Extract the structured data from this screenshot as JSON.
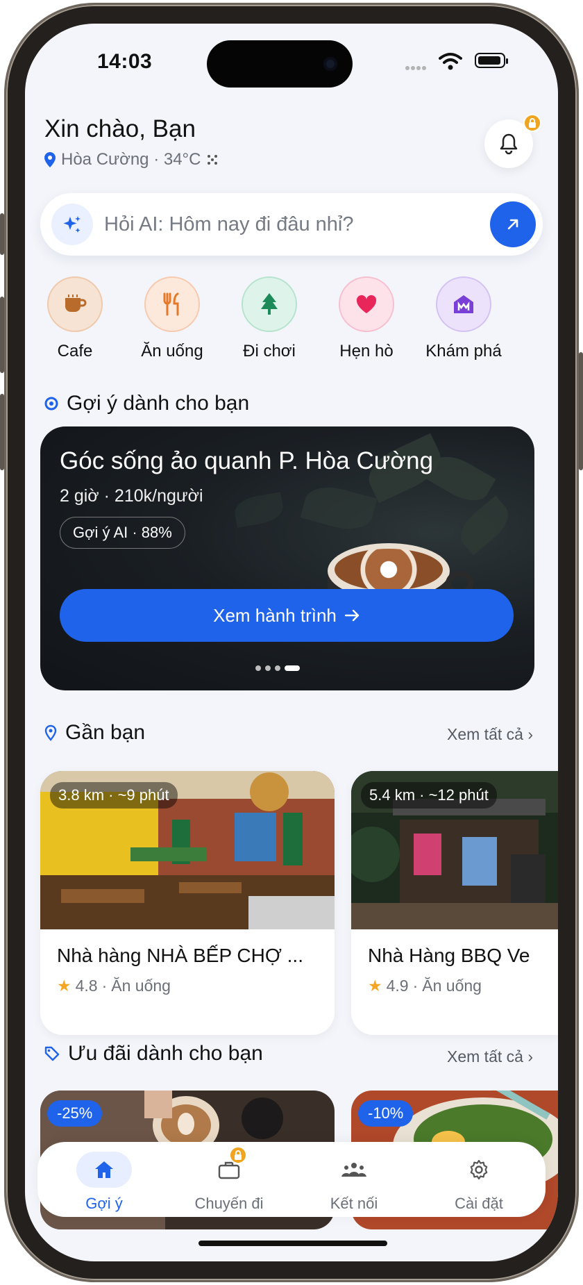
{
  "status": {
    "time": "14:03"
  },
  "header": {
    "greeting": "Xin chào, Bạn",
    "location": "Hòa Cường · 34°C"
  },
  "search": {
    "placeholder": "Hỏi AI: Hôm nay đi đâu nhỉ?"
  },
  "categories": [
    {
      "label": "Cafe",
      "icon": "coffee-icon",
      "color": "#b86b2b"
    },
    {
      "label": "Ăn uống",
      "icon": "fork-knife-icon",
      "color": "#e4792a"
    },
    {
      "label": "Đi chơi",
      "icon": "tree-icon",
      "color": "#1d8a5a"
    },
    {
      "label": "Hẹn hò",
      "icon": "heart-icon",
      "color": "#e8265a"
    },
    {
      "label": "Khám phá",
      "icon": "museum-icon",
      "color": "#7a3fd6"
    }
  ],
  "suggest": {
    "section_title": "Gợi ý dành cho bạn",
    "card": {
      "title": "Góc sống ảo quanh P. Hòa Cường",
      "subtitle": "2 giờ · 210k/người",
      "ai_chip": "Gợi ý AI · 88%",
      "button": "Xem hành trình"
    },
    "carousel_pages": 4,
    "carousel_active": 4
  },
  "nearby": {
    "section_title": "Gần bạn",
    "see_all": "Xem tất cả",
    "items": [
      {
        "distance": "3.8 km · ~9 phút",
        "name": "Nhà hàng NHÀ BẾP CHỢ ...",
        "rating": "4.8",
        "category": "Ăn uống"
      },
      {
        "distance": "5.4 km · ~12 phút",
        "name": "Nhà Hàng BBQ Ve",
        "rating": "4.9",
        "category": "Ăn uống"
      }
    ]
  },
  "deals": {
    "section_title": "Ưu đãi dành cho bạn",
    "see_all": "Xem tất cả",
    "items": [
      {
        "discount": "-25%"
      },
      {
        "discount": "-10%"
      }
    ]
  },
  "tabs": [
    {
      "label": "Gợi ý",
      "icon": "home-icon",
      "active": true
    },
    {
      "label": "Chuyến đi",
      "icon": "briefcase-icon",
      "active": false
    },
    {
      "label": "Kết nối",
      "icon": "people-icon",
      "active": false
    },
    {
      "label": "Cài đặt",
      "icon": "gear-icon",
      "active": false
    }
  ],
  "colors": {
    "accent": "#1f63ea",
    "lock_badge": "#f0a420",
    "star": "#f5a623"
  }
}
